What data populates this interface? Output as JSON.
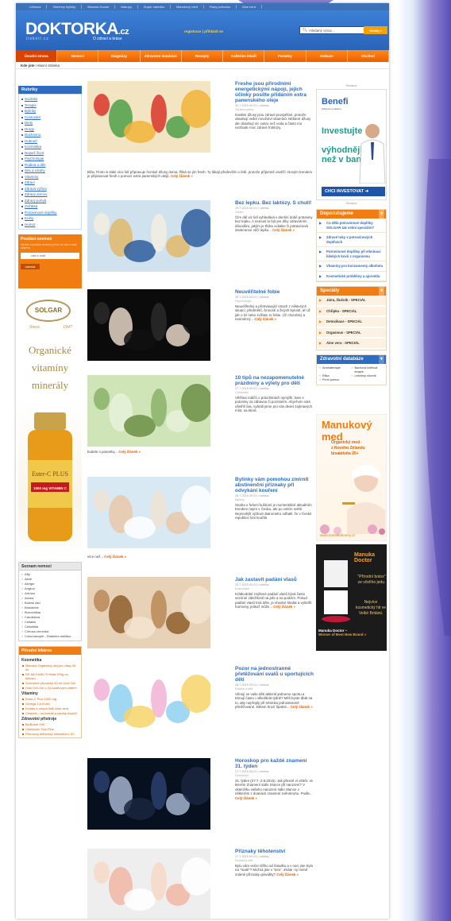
{
  "topnav": [
    "Lékárna",
    "Všechny bylinky",
    "Manuka Doctor",
    "Nákupy",
    "Super nabídka",
    "Manukový med",
    "Rady pohodou",
    "Aloe vera"
  ],
  "header": {
    "logo_main": "DOKTORKA",
    "logo_suffix": ".cz",
    "logo_sub": "tisknil.cz",
    "tagline": "O zdraví a kráse",
    "register_link": "registrace | přihlásit se",
    "search_placeholder": "Hledaný výraz...",
    "search_button": "Hledej »"
  },
  "mainnav": [
    "Úvodní strana",
    "Nemoci",
    "Diagnózy",
    "Zdravotní databáze",
    "Recepty",
    "Galleries lékaři",
    "Poradny",
    "Diskuze",
    "Obchod"
  ],
  "breadcrumb": {
    "prefix": "Kde jste:",
    "current": "Hlavní stránka"
  },
  "rubriky": {
    "title": "Rubriky",
    "items": [
      "Souhlás",
      "Terapie",
      "Bylinky",
      "Cestování",
      "Diety",
      "Drogy",
      "Duchovno",
      "Hubnutí",
      "Kosmetika",
      "Nejsež život",
      "Psychologie",
      "Rodina a děti",
      "Sex a vztahy",
      "Vitamíny",
      "Zdraví",
      "Zdravá výživa",
      "Zdravý domov",
      "Zdravý pohyb",
      "Zvířátka",
      "Potravinové doplňky",
      "Knihy",
      "Humor"
    ]
  },
  "newsletter": {
    "title": "Posílání novinek",
    "desc": "Nechte si posílat novinky přímo na váš e-mail zdarma",
    "input": "váš e-mail",
    "button": "odeslat"
  },
  "solgar": {
    "brand": "SOLGAR",
    "since": "Since",
    "year": "1947",
    "line1": "Organické",
    "line2": "vitamíny",
    "line3": "minerály",
    "bottle_label1": "Ester-C PLUS",
    "bottle_label2": "1000 mg VITAMIN C"
  },
  "seznam": {
    "title": "Seznam nemocí",
    "items": [
      "Afty",
      "Akné",
      "Alergie",
      "Angína",
      "Artróza",
      "Astma",
      "Bolesti zad",
      "Bradavice",
      "Bronchitida",
      "Candidóza",
      "Celiakie",
      "Cellulitida",
      "Cirhóza chronika",
      "Colonoskopie - Diabetes mellitus"
    ]
  },
  "prirodni": {
    "title": "Přírodní lékárna",
    "sections": [
      {
        "name": "Kosmetika",
        "items": [
          "Manuka Organický olej pro vlasy 30 ml",
          "DR.MICHAEL'S Maat 200g na kůžoku",
          "Ochranné přípravky 50 ml Gold Gel",
          "Gold Gel-Gel s 24-karátovým zlatem"
        ]
      },
      {
        "name": "Vitamíny",
        "items": [
          "Ester-C Plus 1000 mg",
          "Omega 3,6,9 olej",
          "Extrakt z celých listů Aloe vera",
          "Celadrin - na bolesti a záněty kloubů"
        ]
      },
      {
        "name": "Zdravotní přístroje",
        "items": [
          "BioBeam 940",
          "Chelatorní Test Plus",
          "Přenosný elektrický stimulátor LSC"
        ]
      }
    ]
  },
  "articles": [
    {
      "title": "Freshe jsou přírodními energetickými nápoji, jejich účinky posílte přidáním extra panenského oleje",
      "meta": "30.7.2015 00:01 | rubrika:",
      "cat": "Zdravá výživa",
      "body": "Kvalitní džusy jsou zdravé prospěšné, protože obsahují velké množství vitamínů. Některé džusy ale obsahují víc cukru než voda a často mu nezbude moc zdravé fruktózy.",
      "full": "Břáv. Proto si stále více lidí připravuje čerstvé džusy doma. Říká se jim fresh. Ty lákají především v létě, protože příjemně osvěží. Novým trendem je připravovat fresh s pomocí extra panenských olejů.",
      "more": "Celý článek »"
    },
    {
      "title": "Bez lepku. Bez laktózy. S chutí!",
      "meta": "29.7.2015 00:01 | rubrika:",
      "cat": "Zdraví",
      "body": "Čím dál víc lidí vyhledává v dnešní době potraviny bez lepku. A nemusí to být jen díky zdravotním důvodům, jakým je třeba celiakie či potravinová intolerance vůči lepku...",
      "full": "",
      "more": "Celý článek »"
    },
    {
      "title": "Neuvěřitelné fobie",
      "meta": "28.7.2015 00:01 | rubrika:",
      "cat": "Psychologie",
      "body": "Neuvěřitelný a přetrvávající strach z některých situací, předmětů, činností a živých bytostí, ať už jde o lví nebo zvířata: to fobie. Úč chorobný a neúměrný...",
      "full": "",
      "more": "Celý článek »"
    },
    {
      "title": "10 tipů na nezapomenutelné prázdniny a výlety pro děti",
      "meta": "27.7.2015 00:01 | rubrika:",
      "cat": "Cestování",
      "body": "Většina rodičů o prázdninách vymýšlí, kam s potomky za zábavou či poznáním. Abychom vám ušetřili čas, vybrali jsme pro vás deset zajímavých míst, na která",
      "full": "budete s potomky...",
      "more": "Celý článek »"
    },
    {
      "title": "Bylinky vám pomohou zmírnit abstinenční příznaky při odvykání kouření",
      "meta": "26.7.2015 00:01 | rubrika:",
      "cat": "Bylinky",
      "body": "Snaha o řešení kuřáctví je momentálně aktuálním trendem nejen v Česku, ale po celém světě. Nejnovější výzkum Barometru odhalil, že v České republice loni kouřila",
      "full": "více než...",
      "more": "Celý článek »"
    },
    {
      "title": "Jak zastavit padání vlasů",
      "meta": "25.7.2015 00:01 | rubrika:",
      "cat": "Kosmetika",
      "body": "Krátkodobé zvýšené padání vlasů bývá často sezónní záležitostí na jaře a na podzim. Pokud padání vlasů trvá déle, je vhodné hledat a vyšetřit hormony, jelikož může...",
      "full": "",
      "more": "Celý článek »"
    },
    {
      "title": "Pozor na jednostranné přetěžování svalů u sportujících dětí",
      "meta": "28.7.2015 00:01 | rubrika:",
      "cat": "Rodina a děti",
      "body": "Věnují se vaše děti aktivně jednomu sportu a trénují často i několikrát týdně? Měli byste dbát na to, aby nepřeply při tréninku jednostranně přetěžované. Dětem hrozí špatné...",
      "full": "",
      "more": "Celý článek »"
    },
    {
      "title": "Horoskop pro každé znamení 31. týden",
      "meta": "27.7.2015 00:01 | rubrika:",
      "cat": "Duchovno",
      "body": "31. týden (27.7.-2.8.2015). Jak přesně ví vědět, ve kterém Znamení stálo Slunce při narození? V okamžiku vašeho narození stálo Slunce v některém z dvanácti znamení zvěrokruhu. Podle...",
      "full": "",
      "more": "Celý článek »"
    },
    {
      "title": "Příznaky těhotenství",
      "meta": "27.7.2015 00:01 | rubrika:",
      "cat": "Rodina a děti",
      "body": "Bylo vám večer těžko od žaludku a v noci jste byla na \"malé\"? Možná jste v \"tom\". Znáte i ty méně známé příznaky gravidity?",
      "full": "",
      "more": "Celý článek »"
    }
  ],
  "ad_label": "Reklama",
  "benefit_ad": {
    "brand": "Benefi",
    "brand_sub": "Zdravotní pojištění",
    "line1": "Investujte",
    "line2": "výhodněji",
    "line3": "než v bance",
    "button": "CHCI INVESTOVAT ➜"
  },
  "doporucujeme": {
    "title": "Doporučujeme",
    "items": [
      "Co dělá potravinové doplňky SOLGAR tak velmi speciální?",
      "Zdravé tuky v potravinových doplňcích",
      "Potravinové doplňky při eliminaci lidských kovů z organismu",
      "Vitamíny pro konzumenty alkoholu",
      "Kosmetické problémy a ajurvéda"
    ]
  },
  "specialy": {
    "title": "Speciály",
    "items": [
      "Játra, žlučník - SPECIÁL",
      "Chřipka - SPECIÁL",
      "Detoxikace - SPECIÁL",
      "Orgasmus - SPECIÁL",
      "Aloe vera - SPECIÁL"
    ]
  },
  "databaze": {
    "title": "Zdravotní databáze",
    "items": [
      "Aromaterapie",
      "Bachova květová terapie",
      "Etika",
      "Léčebný slovník",
      "První pomoc"
    ]
  },
  "manuka_ad": {
    "title": "Manukový med",
    "line1": "Organický med",
    "line2": "z Nového Zélandu",
    "line3": "bioaktivita 25+",
    "url": "www.manukahoney.cz"
  },
  "manukadoc_ad": {
    "brand": "Manuka Doctor",
    "claim1": "\"Přírodní botox\" ze včelího jedu.",
    "claim2": "Nejvíce kosmetický hit ve Velké Británii.",
    "caption": "Manuka Doctor –",
    "caption2": "Winner of Best New Brand »"
  }
}
